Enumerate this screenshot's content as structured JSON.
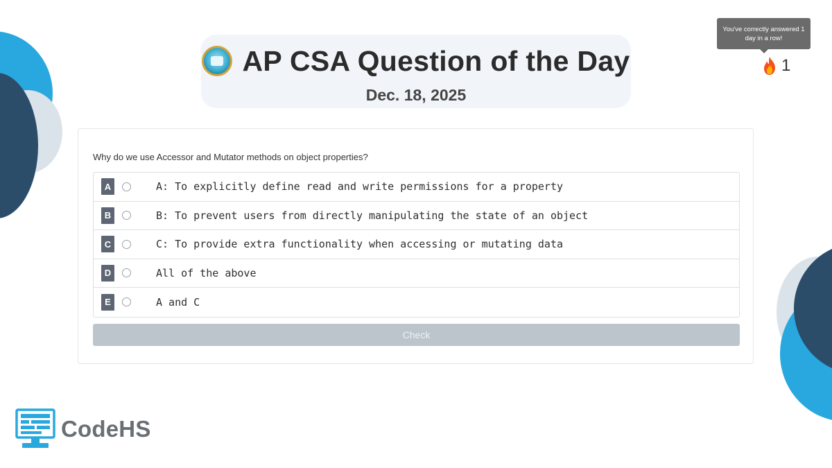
{
  "header": {
    "title": "AP CSA Question of the Day",
    "date": "Dec. 18, 2025"
  },
  "streak": {
    "tooltip": "You've correctly answered 1 day in a row!",
    "count": "1"
  },
  "question": {
    "prompt": "Why do we use Accessor and Mutator methods on object properties?",
    "choices": [
      {
        "letter": "A",
        "text": "A: To explicitly define read and write permissions for a property"
      },
      {
        "letter": "B",
        "text": "B: To prevent users from directly manipulating the state of an object"
      },
      {
        "letter": "C",
        "text": "C: To provide extra functionality when accessing or mutating data"
      },
      {
        "letter": "D",
        "text": "All of the above"
      },
      {
        "letter": "E",
        "text": "A and C"
      }
    ],
    "check_label": "Check"
  },
  "brand": {
    "wordmark": "CodeHS"
  },
  "colors": {
    "light_blue": "#29a8e0",
    "dark_navy": "#2a4d6b",
    "slate_gray": "#5d6672",
    "button_disabled": "#bcc5cc"
  }
}
